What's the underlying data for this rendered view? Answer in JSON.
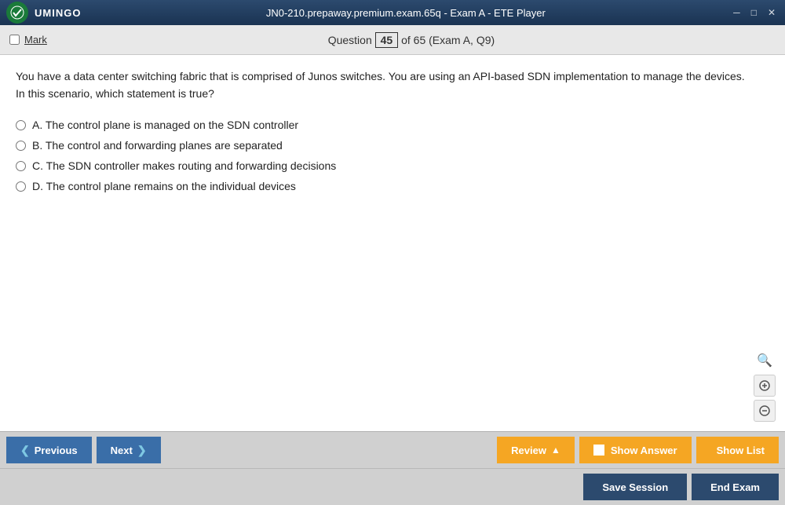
{
  "titleBar": {
    "title": "JN0-210.prepaway.premium.exam.65q - Exam A - ETE Player",
    "logoText": "UMINGO",
    "windowControls": [
      "─",
      "□",
      "✕"
    ]
  },
  "toolbar": {
    "markLabel": "Mark",
    "questionLabel": "Question",
    "questionNumber": "45",
    "questionTotal": "of 65 (Exam A, Q9)"
  },
  "question": {
    "text1": "You have a data center switching fabric that is comprised of Junos switches. You are using an API-based SDN implementation to manage the devices.",
    "text2": "In this scenario, which statement is true?",
    "options": [
      {
        "id": "A",
        "label": "A. The control plane is managed on the SDN controller"
      },
      {
        "id": "B",
        "label": "B. The control and forwarding planes are separated"
      },
      {
        "id": "C",
        "label": "C. The SDN controller makes routing and forwarding decisions"
      },
      {
        "id": "D",
        "label": "D. The control plane remains on the individual devices"
      }
    ]
  },
  "bottomBar": {
    "previousLabel": "Previous",
    "nextLabel": "Next",
    "reviewLabel": "Review",
    "showAnswerLabel": "Show Answer",
    "showListLabel": "Show List"
  },
  "actionBar": {
    "saveSessionLabel": "Save Session",
    "endExamLabel": "End Exam"
  },
  "zoom": {
    "searchIcon": "🔍",
    "zoomInIcon": "⊕",
    "zoomOutIcon": "⊖"
  }
}
